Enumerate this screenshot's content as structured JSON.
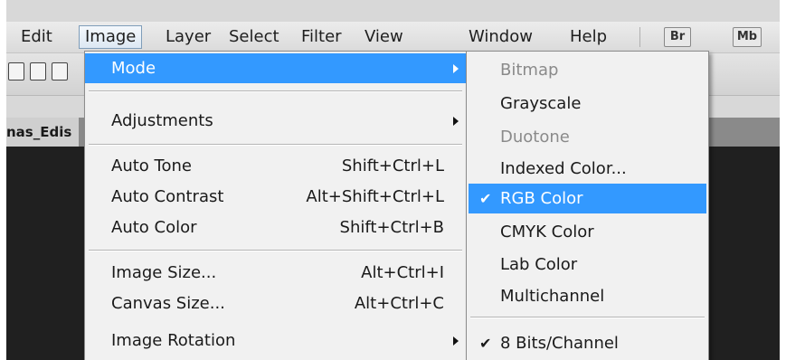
{
  "menubar": {
    "items": [
      "Edit",
      "Image",
      "Layer",
      "Select",
      "Filter",
      "View",
      "Window",
      "Help"
    ],
    "badges": [
      "Br",
      "Mb"
    ]
  },
  "document": {
    "tab_label": "nas_Edis"
  },
  "image_menu": {
    "items": [
      {
        "label": "Mode",
        "shortcut": "",
        "submenu": true
      },
      {
        "label": "Adjustments",
        "shortcut": "",
        "submenu": true
      },
      {
        "label": "Auto Tone",
        "shortcut": "Shift+Ctrl+L"
      },
      {
        "label": "Auto Contrast",
        "shortcut": "Alt+Shift+Ctrl+L"
      },
      {
        "label": "Auto Color",
        "shortcut": "Shift+Ctrl+B"
      },
      {
        "label": "Image Size...",
        "shortcut": "Alt+Ctrl+I"
      },
      {
        "label": "Canvas Size...",
        "shortcut": "Alt+Ctrl+C"
      },
      {
        "label": "Image Rotation",
        "shortcut": "",
        "submenu": true
      }
    ]
  },
  "mode_submenu": {
    "items": [
      {
        "label": "Bitmap",
        "disabled": true
      },
      {
        "label": "Grayscale"
      },
      {
        "label": "Duotone",
        "disabled": true
      },
      {
        "label": "Indexed Color..."
      },
      {
        "label": "RGB Color",
        "checked": true,
        "highlighted": true
      },
      {
        "label": "CMYK Color"
      },
      {
        "label": "Lab Color"
      },
      {
        "label": "Multichannel"
      },
      {
        "label": "8 Bits/Channel",
        "checked": true
      }
    ],
    "check_glyph": "✔"
  },
  "colors": {
    "highlight": "#3399ff",
    "menu_bg": "#f1f1f1",
    "disabled_text": "#8a8a8a",
    "canvas": "#202020"
  }
}
